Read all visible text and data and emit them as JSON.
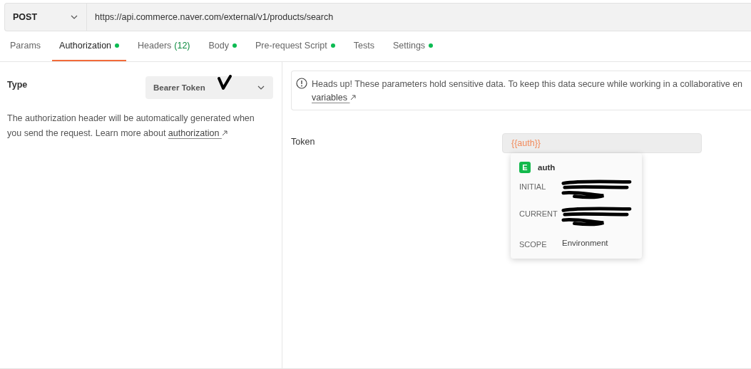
{
  "request": {
    "method": "POST",
    "url": "https://api.commerce.naver.com/external/v1/products/search"
  },
  "tabs": [
    {
      "label": "Params",
      "selected": false,
      "dot": false
    },
    {
      "label": "Authorization",
      "selected": true,
      "dot": true
    },
    {
      "label": "Headers",
      "count": "(12)",
      "selected": false,
      "dot": false
    },
    {
      "label": "Body",
      "selected": false,
      "dot": true
    },
    {
      "label": "Pre-request Script",
      "selected": false,
      "dot": true
    },
    {
      "label": "Tests",
      "selected": false,
      "dot": false
    },
    {
      "label": "Settings",
      "selected": false,
      "dot": true
    }
  ],
  "auth": {
    "type_label": "Type",
    "type_value": "Bearer Token",
    "description": "The authorization header will be automatically generated when you send the request. Learn more about",
    "link": "authorization"
  },
  "alert": {
    "text": "Heads up! These parameters hold sensitive data. To keep this data secure while working in a collaborative en",
    "link": "variables"
  },
  "token": {
    "label": "Token",
    "value": "{{auth}}"
  },
  "popup": {
    "badge": "E",
    "name": "auth",
    "rows": [
      {
        "label": "INITIAL",
        "redacted": true
      },
      {
        "label": "CURRENT",
        "redacted": true
      },
      {
        "label": "SCOPE",
        "value": "Environment",
        "redacted": false
      }
    ]
  }
}
